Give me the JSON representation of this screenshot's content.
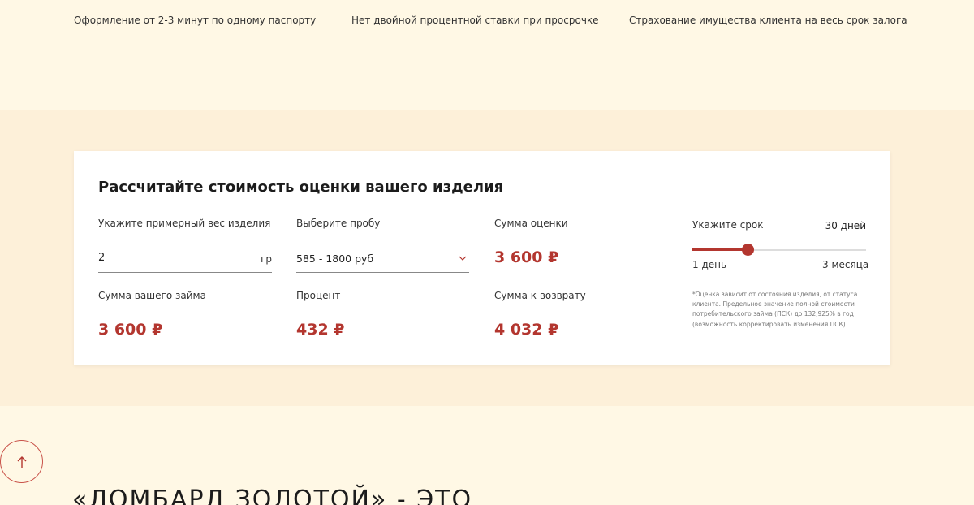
{
  "features": [
    "Оформление от 2-3 минут по одному паспорту",
    "Нет двойной процентной ставки при просрочке",
    "Страхование имущества клиента на весь срок залога"
  ],
  "calculator": {
    "title": "Рассчитайте стоимость оценки вашего изделия",
    "weight": {
      "label": "Укажите примерный вес изделия",
      "value": "2",
      "unit": "гр"
    },
    "probe": {
      "label": "Выберите пробу",
      "selected": "585 - 1800 руб"
    },
    "appraisal": {
      "label": "Сумма оценки",
      "value": "3 600 ₽"
    },
    "loan": {
      "label": "Сумма вашего займа",
      "value": "3 600 ₽"
    },
    "percent": {
      "label": "Процент",
      "value": "432 ₽"
    },
    "return": {
      "label": "Сумма к возврату",
      "value": "4 032 ₽"
    },
    "term": {
      "label": "Укажите срок",
      "value": "30 дней",
      "min_label": "1 день",
      "max_label": "3 месяца",
      "slider_fraction": 0.32
    },
    "note": "*Оценка зависит от состояния изделия, от статуса клиента. Предельное значение полной стоимости потребительского займа (ПСК) до 132,925% в год (возможность корректировать изменения ПСК)"
  },
  "heading": "«ЛОМБАРД ЗОЛОТОЙ» - ЭТО",
  "colors": {
    "accent": "#b3362f",
    "background": "#fff8e5",
    "section": "#fdf0d9"
  },
  "icons": {
    "select": "chevron-down-icon",
    "scroll": "arrow-up-icon"
  }
}
